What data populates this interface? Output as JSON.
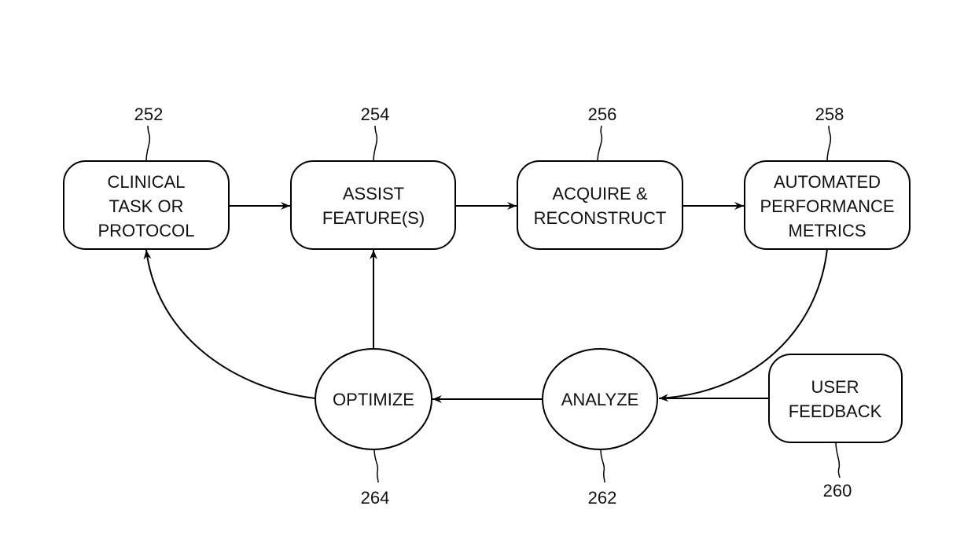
{
  "diagram": {
    "nodes": [
      {
        "id": "252",
        "ref": "252",
        "shape": "rounded-box",
        "lines": [
          "CLINICAL",
          "TASK OR",
          "PROTOCOL"
        ]
      },
      {
        "id": "254",
        "ref": "254",
        "shape": "rounded-box",
        "lines": [
          "ASSIST",
          "FEATURE(S)"
        ]
      },
      {
        "id": "256",
        "ref": "256",
        "shape": "rounded-box",
        "lines": [
          "ACQUIRE &",
          "RECONSTRUCT"
        ]
      },
      {
        "id": "258",
        "ref": "258",
        "shape": "rounded-box",
        "lines": [
          "AUTOMATED",
          "PERFORMANCE",
          "METRICS"
        ]
      },
      {
        "id": "260",
        "ref": "260",
        "shape": "rounded-box",
        "lines": [
          "USER",
          "FEEDBACK"
        ]
      },
      {
        "id": "262",
        "ref": "262",
        "shape": "ellipse",
        "lines": [
          "ANALYZE"
        ]
      },
      {
        "id": "264",
        "ref": "264",
        "shape": "ellipse",
        "lines": [
          "OPTIMIZE"
        ]
      }
    ],
    "edges": [
      {
        "from": "252",
        "to": "254"
      },
      {
        "from": "254",
        "to": "256"
      },
      {
        "from": "256",
        "to": "258"
      },
      {
        "from": "258",
        "to": "262"
      },
      {
        "from": "260",
        "to": "262"
      },
      {
        "from": "262",
        "to": "264"
      },
      {
        "from": "264",
        "to": "254"
      },
      {
        "from": "264",
        "to": "252"
      }
    ]
  }
}
